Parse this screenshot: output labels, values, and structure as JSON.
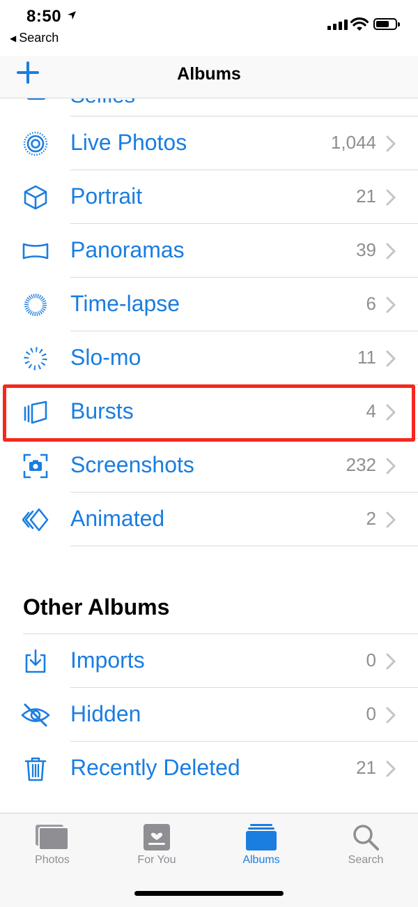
{
  "status": {
    "time": "8:50",
    "back_label": "Search"
  },
  "nav": {
    "title": "Albums"
  },
  "cutoff_row": {
    "label": "Selfies"
  },
  "media_types": [
    {
      "label": "Live Photos",
      "count": "1,044",
      "icon": "live-photos-icon"
    },
    {
      "label": "Portrait",
      "count": "21",
      "icon": "portrait-cube-icon"
    },
    {
      "label": "Panoramas",
      "count": "39",
      "icon": "panorama-icon"
    },
    {
      "label": "Time-lapse",
      "count": "6",
      "icon": "time-lapse-icon"
    },
    {
      "label": "Slo-mo",
      "count": "11",
      "icon": "slo-mo-icon"
    },
    {
      "label": "Bursts",
      "count": "4",
      "icon": "bursts-icon"
    },
    {
      "label": "Screenshots",
      "count": "232",
      "icon": "screenshot-icon"
    },
    {
      "label": "Animated",
      "count": "2",
      "icon": "animated-icon"
    }
  ],
  "other_albums": {
    "title": "Other Albums",
    "items": [
      {
        "label": "Imports",
        "count": "0",
        "icon": "import-icon"
      },
      {
        "label": "Hidden",
        "count": "0",
        "icon": "hidden-eye-icon"
      },
      {
        "label": "Recently Deleted",
        "count": "21",
        "icon": "trash-icon"
      }
    ]
  },
  "tabs": [
    {
      "label": "Photos",
      "icon": "photos-tab-icon",
      "active": false
    },
    {
      "label": "For You",
      "icon": "for-you-tab-icon",
      "active": false
    },
    {
      "label": "Albums",
      "icon": "albums-tab-icon",
      "active": true
    },
    {
      "label": "Search",
      "icon": "search-tab-icon",
      "active": false
    }
  ],
  "colors": {
    "accent": "#1a7de0",
    "highlight": "#f5281e",
    "secondary_text": "#8e8e93"
  }
}
